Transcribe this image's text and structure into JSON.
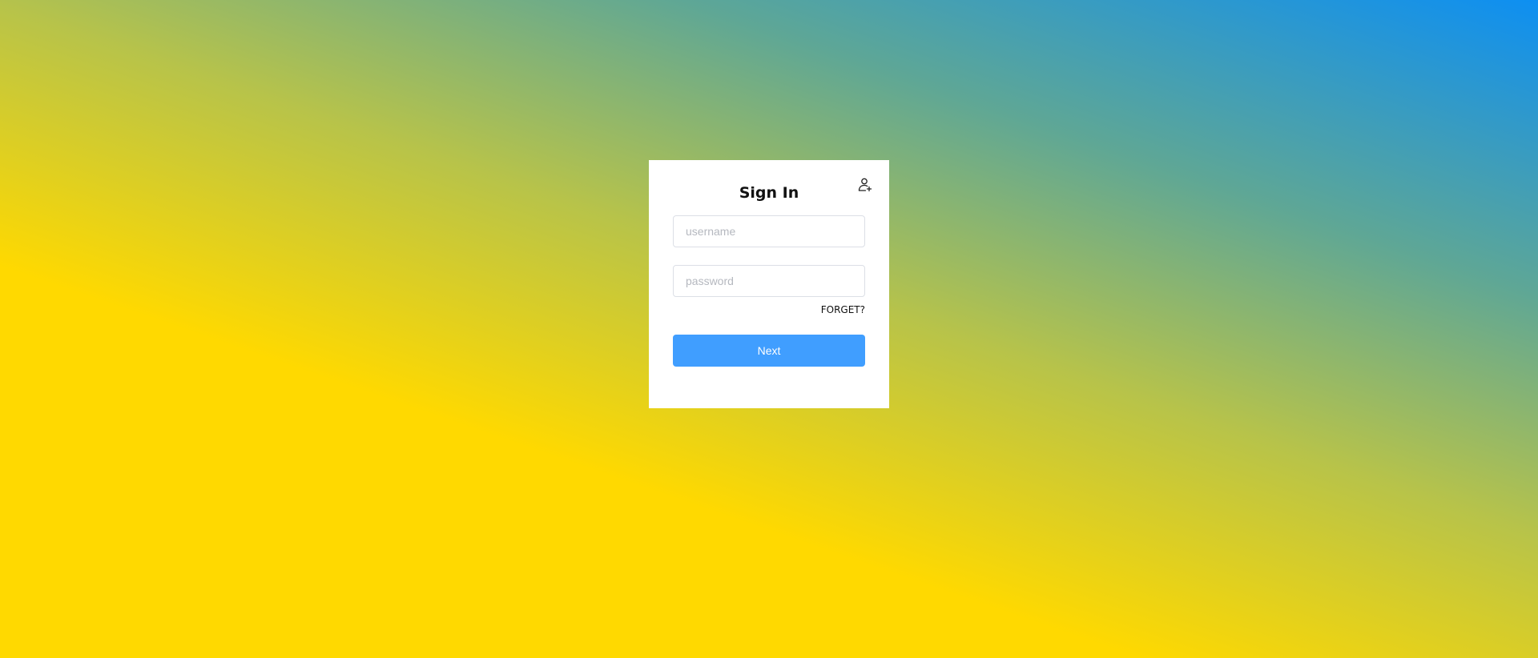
{
  "background": {
    "colors": [
      "#ffd900",
      "#b7c34a",
      "#5fa795",
      "#0d8ff2"
    ]
  },
  "login_card": {
    "title": "Sign In",
    "register_icon": "add-user-icon",
    "username": {
      "placeholder": "username",
      "value": ""
    },
    "password": {
      "placeholder": "password",
      "value": ""
    },
    "forget_label": "FORGET?",
    "next_label": "Next",
    "accent_color": "#409eff"
  }
}
